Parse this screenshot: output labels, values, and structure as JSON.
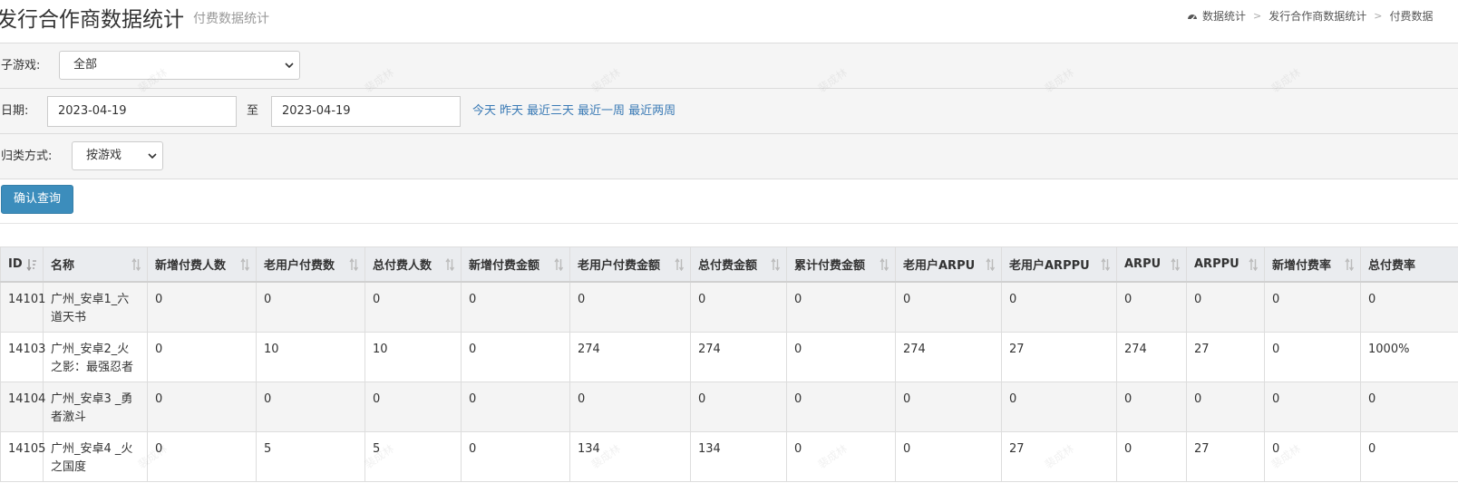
{
  "header": {
    "title": "发行合作商数据统计",
    "subtitle": "付费数据统计",
    "breadcrumb": [
      "数据统计",
      "发行合作商数据统计",
      "付费数据"
    ]
  },
  "filters": {
    "subgame_label": "子游戏:",
    "subgame_value": "全部",
    "date_label": "日期:",
    "date_from": "2023-04-19",
    "date_to_label": "至",
    "date_to": "2023-04-19",
    "quick_ranges": [
      "今天",
      "昨天",
      "最近三天",
      "最近一周",
      "最近两周"
    ],
    "group_label": "归类方式:",
    "group_value": "按游戏"
  },
  "confirm_button": "确认查询",
  "table": {
    "columns": [
      "ID",
      "名称",
      "新增付费人数",
      "老用户付费数",
      "总付费人数",
      "新增付费金额",
      "老用户付费金额",
      "总付费金额",
      "累计付费金额",
      "老用户ARPU",
      "老用户ARPPU",
      "ARPU",
      "ARPPU",
      "新增付费率",
      "总付费率"
    ],
    "rows": [
      [
        "14101",
        "广州_安卓1_六道天书",
        "0",
        "0",
        "0",
        "0",
        "0",
        "0",
        "0",
        "0",
        "0",
        "0",
        "0",
        "0",
        "0"
      ],
      [
        "14103",
        "广州_安卓2_火之影：最强忍者",
        "0",
        "10",
        "10",
        "0",
        "274",
        "274",
        "0",
        "274",
        "27",
        "274",
        "27",
        "0",
        "1000%"
      ],
      [
        "14104",
        "广州_安卓3 _勇者激斗",
        "0",
        "0",
        "0",
        "0",
        "0",
        "0",
        "0",
        "0",
        "0",
        "0",
        "0",
        "0",
        "0"
      ],
      [
        "14105",
        "广州_安卓4 _火之国度",
        "0",
        "5",
        "5",
        "0",
        "134",
        "134",
        "0",
        "0",
        "27",
        "0",
        "27",
        "0",
        "0"
      ]
    ]
  },
  "watermark_text": "裴成林"
}
